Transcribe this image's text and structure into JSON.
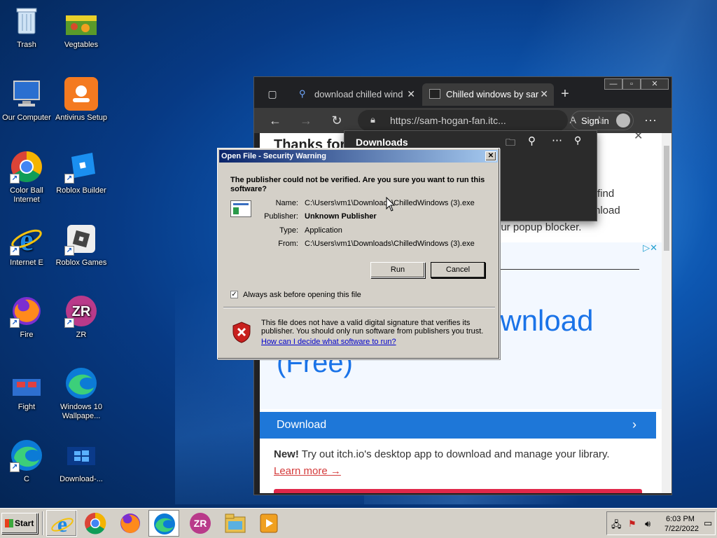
{
  "desktop": {
    "icons": [
      {
        "label": "Trash"
      },
      {
        "label": "Vegtables"
      },
      {
        "label": "Our Computer"
      },
      {
        "label": "Antivirus Setup"
      },
      {
        "label": "Color Ball Internet"
      },
      {
        "label": "Roblox Builder"
      },
      {
        "label": "Internet E"
      },
      {
        "label": "Roblox Games"
      },
      {
        "label": "Fire"
      },
      {
        "label": "ZR"
      },
      {
        "label": "Fight"
      },
      {
        "label": "Windows 10 Wallpape..."
      },
      {
        "label": "C"
      },
      {
        "label": "Download-..."
      }
    ]
  },
  "browser": {
    "tabs": [
      {
        "label": "download chilled wind"
      },
      {
        "label": "Chilled windows by sar"
      }
    ],
    "address": "https://sam-hogan-fan.itc...",
    "signin": "Sign in",
    "downloads_title": "Downloads",
    "page": {
      "heading": "Thanks for d",
      "side1": "find",
      "side2": "nload",
      "popup": "our popup blocker.",
      "ad_big": "ownload",
      "ad_free": "(Free)",
      "download_btn": "Download",
      "new_label": "New!",
      "promo": " Try out itch.io's desktop app to download and manage your library.",
      "learn": "Learn more →"
    }
  },
  "dialog": {
    "title": "Open File - Security Warning",
    "question": "The publisher could not be verified.  Are you sure you want to run this software?",
    "fields": [
      {
        "label": "Name:",
        "value": "C:\\Users\\vm1\\Downloads\\ChilledWindows (3).exe"
      },
      {
        "label": "Publisher:",
        "value": "Unknown Publisher"
      },
      {
        "label": "Type:",
        "value": "Application"
      },
      {
        "label": "From:",
        "value": "C:\\Users\\vm1\\Downloads\\ChilledWindows (3).exe"
      }
    ],
    "run": "Run",
    "cancel": "Cancel",
    "checkbox": "Always ask before opening this file",
    "warning": "This file does not have a valid digital signature that verifies its publisher.  You should only run software from publishers you trust.",
    "link": "How can I decide what software to run?"
  },
  "taskbar": {
    "start": "Start",
    "time": "6:03 PM",
    "date": "7/22/2022"
  }
}
